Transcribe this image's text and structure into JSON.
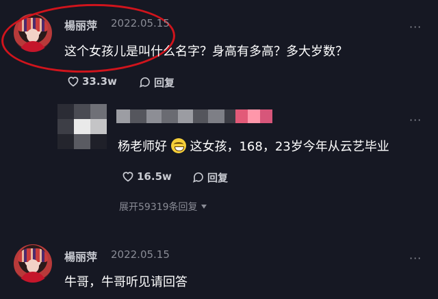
{
  "comments": [
    {
      "username": "楊丽萍",
      "date": "2022.05.15",
      "text": "这个女孩儿是叫什么名字？身高有多高？多大岁数？",
      "likes": "33.3w",
      "reply_label": "回复",
      "more_label": "···"
    },
    {
      "username": "",
      "text_prefix": "杨老师好",
      "text_suffix": "这女孩，168，23岁今年从云艺毕业",
      "likes": "16.5w",
      "reply_label": "回复",
      "more_label": "···",
      "expand_label": "展开59319条回复"
    },
    {
      "username": "楊丽萍",
      "date": "2022.05.15",
      "text": "牛哥，牛哥听见请回答",
      "more_label": "···"
    }
  ],
  "colors": {
    "background": "#161823",
    "highlight_ring": "#d0141c"
  }
}
